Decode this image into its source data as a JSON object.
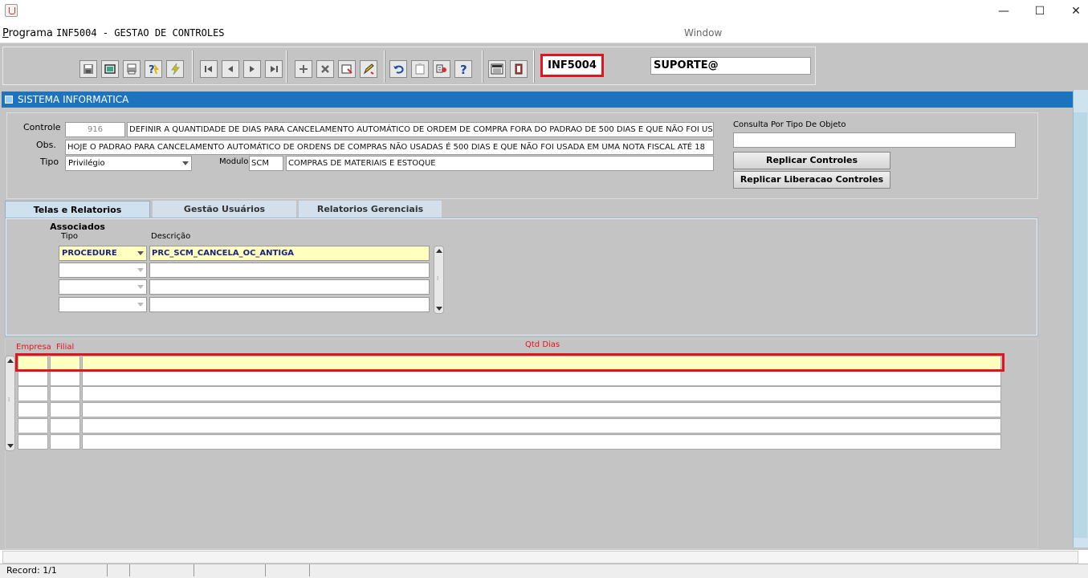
{
  "window": {
    "title": "",
    "minimize": "—",
    "maximize": "☐",
    "close": "✕"
  },
  "menu": {
    "programa": "Programa",
    "code_title": "INF5004 - GESTAO DE CONTROLES",
    "window": "Window"
  },
  "toolbar": {
    "form_code": "INF5004",
    "user": "SUPORTE@",
    "buttons": [
      "save-icon",
      "window-icon",
      "print-icon",
      "help-query-icon",
      "execute-icon",
      "first-record-icon",
      "prev-record-icon",
      "next-record-icon",
      "last-record-icon",
      "insert-icon",
      "delete-icon",
      "clear-icon",
      "edit-icon",
      "undo-icon",
      "clipboard-icon",
      "options-icon",
      "help-icon",
      "menu-icon",
      "exit-icon"
    ]
  },
  "panel": {
    "title": "SISTEMA INFORMATICA"
  },
  "form": {
    "controle_label": "Controle",
    "controle_value": "916",
    "controle_desc": "DEFINIR A QUANTIDADE DE DIAS PARA CANCELAMENTO AUTOMÁTICO DE ORDEM DE COMPRA FORA DO PADRAO DE 500 DIAS E QUE NÃO FOI USA",
    "obs_label": "Obs.",
    "obs_value": "HOJE O PADRAO PARA CANCELAMENTO AUTOMÁTICO DE ORDENS DE COMPRAS NÃO USADAS É 500 DIAS E QUE NÃO FOI USADA EM UMA NOTA FISCAL ATÉ 18",
    "tipo_label": "Tipo",
    "tipo_value": "Privilégio",
    "modulo_label": "Modulo",
    "modulo_code": "SCM",
    "modulo_desc": "COMPRAS DE MATERIAIS E ESTOQUE",
    "consulta_label": "Consulta Por Tipo De Objeto",
    "consulta_value": "",
    "replicar_controles": "Replicar Controles",
    "replicar_liberacao": "Replicar Liberacao Controles"
  },
  "tabs": [
    {
      "label": "Telas e Relatorios Associados",
      "active": true
    },
    {
      "label": "Gestão Usuários",
      "active": false
    },
    {
      "label": "Relatorios Gerenciais",
      "active": false
    }
  ],
  "assoc": {
    "col_tipo": "Tipo",
    "col_desc": "Descrição",
    "rows": [
      {
        "tipo": "PROCEDURE",
        "desc": "PRC_SCM_CANCELA_OC_ANTIGA"
      },
      {
        "tipo": "",
        "desc": ""
      },
      {
        "tipo": "",
        "desc": ""
      },
      {
        "tipo": "",
        "desc": ""
      }
    ]
  },
  "detail": {
    "col_empresa": "Empresa",
    "col_filial": "Filial",
    "col_qtd": "Qtd Dias",
    "rows": 6
  },
  "status": {
    "record": "Record: 1/1"
  }
}
